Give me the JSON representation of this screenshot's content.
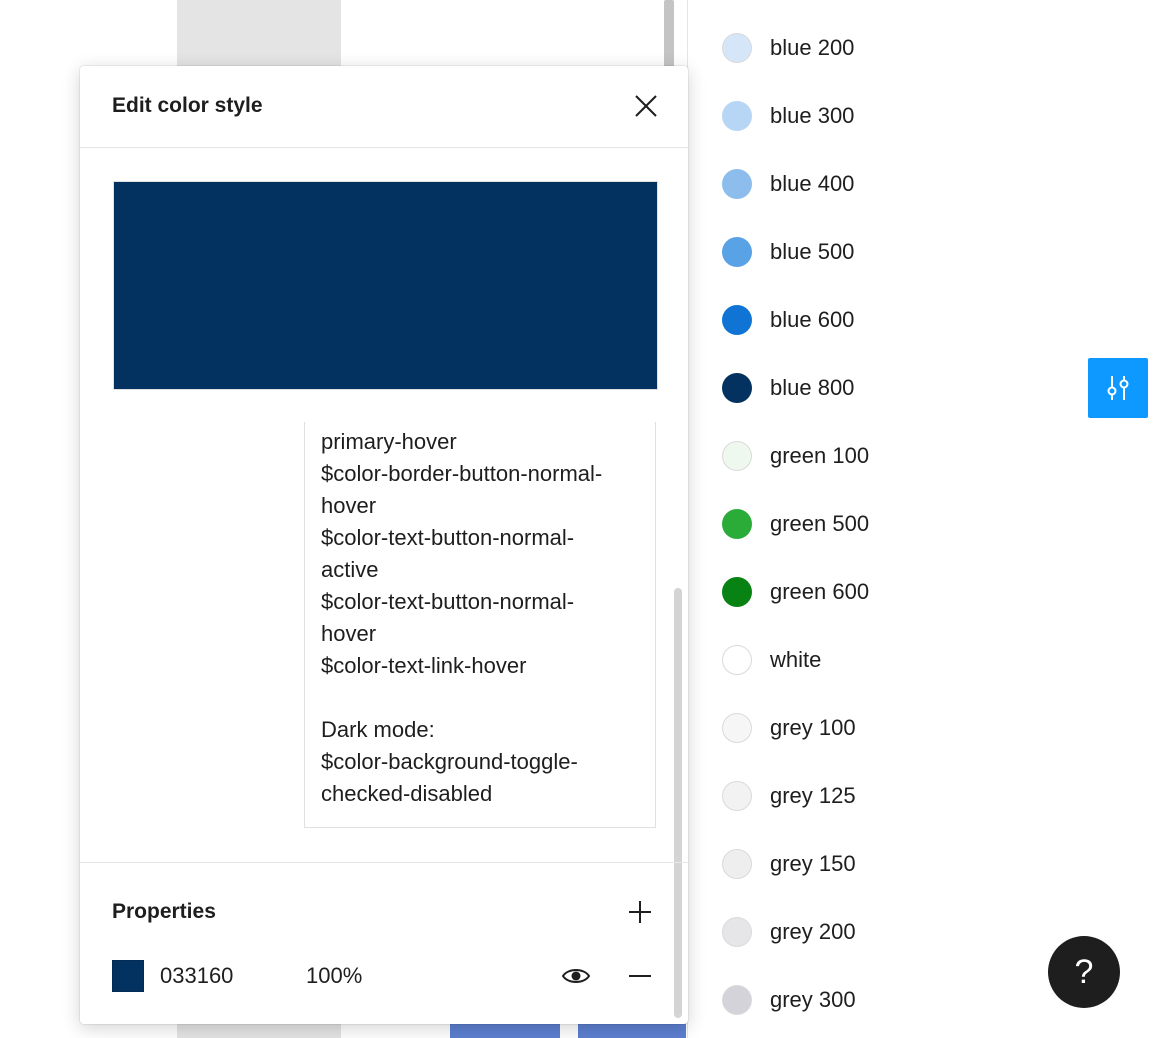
{
  "dialog": {
    "title": "Edit color style",
    "preview_color": "#033160",
    "description_lines": [
      "primary-hover",
      "$color-border-button-normal-",
      "hover",
      "$color-text-button-normal-",
      "active",
      "$color-text-button-normal-",
      "hover",
      "$color-text-link-hover",
      "",
      "Dark mode:",
      "$color-background-toggle-",
      "checked-disabled"
    ],
    "properties": {
      "title": "Properties",
      "fill": {
        "hex": "033160",
        "opacity": "100%",
        "color": "#033160"
      }
    }
  },
  "swatches": [
    {
      "name": "blue 200",
      "color": "#d5e6f8"
    },
    {
      "name": "blue 300",
      "color": "#b7d5f5"
    },
    {
      "name": "blue 400",
      "color": "#8cbded"
    },
    {
      "name": "blue 500",
      "color": "#5aa2e6"
    },
    {
      "name": "blue 600",
      "color": "#0f74d4"
    },
    {
      "name": "blue 800",
      "color": "#033160"
    },
    {
      "name": "green 100",
      "color": "#eef8ee"
    },
    {
      "name": "green 500",
      "color": "#2bab38"
    },
    {
      "name": "green 600",
      "color": "#088213"
    },
    {
      "name": "white",
      "color": "#ffffff"
    },
    {
      "name": "grey 100",
      "color": "#f6f6f6"
    },
    {
      "name": "grey 125",
      "color": "#f2f2f2"
    },
    {
      "name": "grey 150",
      "color": "#eeeeee"
    },
    {
      "name": "grey 200",
      "color": "#e6e6e8"
    },
    {
      "name": "grey 300",
      "color": "#d3d3d9"
    }
  ],
  "icons": {
    "close": "close-icon",
    "add": "plus-icon",
    "visibility": "eye-icon",
    "remove": "minus-icon",
    "settings": "sliders-icon",
    "help": "help-icon"
  },
  "help_label": "?"
}
